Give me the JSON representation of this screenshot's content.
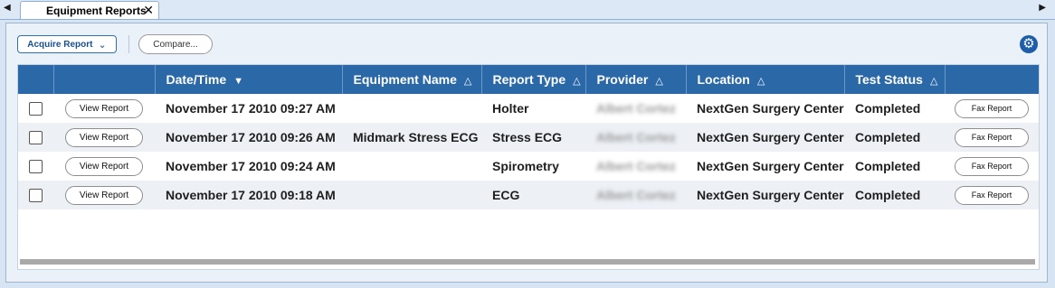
{
  "tabstrip": {
    "active_tab": "Equipment Reports",
    "close_glyph": "✕",
    "left_arrow": "◀",
    "right_arrow": "▶"
  },
  "toolbar": {
    "acquire_label": "Acquire Report",
    "compare_label": "Compare...",
    "settings_icon": "gear-icon"
  },
  "table": {
    "columns": [
      {
        "label": "",
        "sort": ""
      },
      {
        "label": "",
        "sort": ""
      },
      {
        "label": "Date/Time",
        "sort": "▼"
      },
      {
        "label": "Equipment Name",
        "sort": "△"
      },
      {
        "label": "Report Type",
        "sort": "△"
      },
      {
        "label": "Provider",
        "sort": "△"
      },
      {
        "label": "Location",
        "sort": "△"
      },
      {
        "label": "Test Status",
        "sort": "△"
      },
      {
        "label": "",
        "sort": ""
      }
    ],
    "rows": [
      {
        "view": "View Report",
        "datetime": "November 17 2010 09:27 AM",
        "equipment": "",
        "type": "Holter",
        "provider": "Albert Cortez",
        "location": "NextGen Surgery Center",
        "status": "Completed",
        "fax": "Fax Report"
      },
      {
        "view": "View Report",
        "datetime": "November 17 2010 09:26 AM",
        "equipment": "Midmark Stress ECG",
        "type": "Stress ECG",
        "provider": "Albert Cortez",
        "location": "NextGen Surgery Center",
        "status": "Completed",
        "fax": "Fax Report"
      },
      {
        "view": "View Report",
        "datetime": "November 17 2010 09:24 AM",
        "equipment": "",
        "type": "Spirometry",
        "provider": "Albert Cortez",
        "location": "NextGen Surgery Center",
        "status": "Completed",
        "fax": "Fax Report"
      },
      {
        "view": "View Report",
        "datetime": "November 17 2010 09:18 AM",
        "equipment": "",
        "type": "ECG",
        "provider": "Albert Cortez",
        "location": "NextGen Surgery Center",
        "status": "Completed",
        "fax": "Fax Report"
      }
    ]
  },
  "colors": {
    "header_bg": "#2a68a8",
    "accent": "#1e5ea8",
    "alt_row": "#edf1f6"
  }
}
